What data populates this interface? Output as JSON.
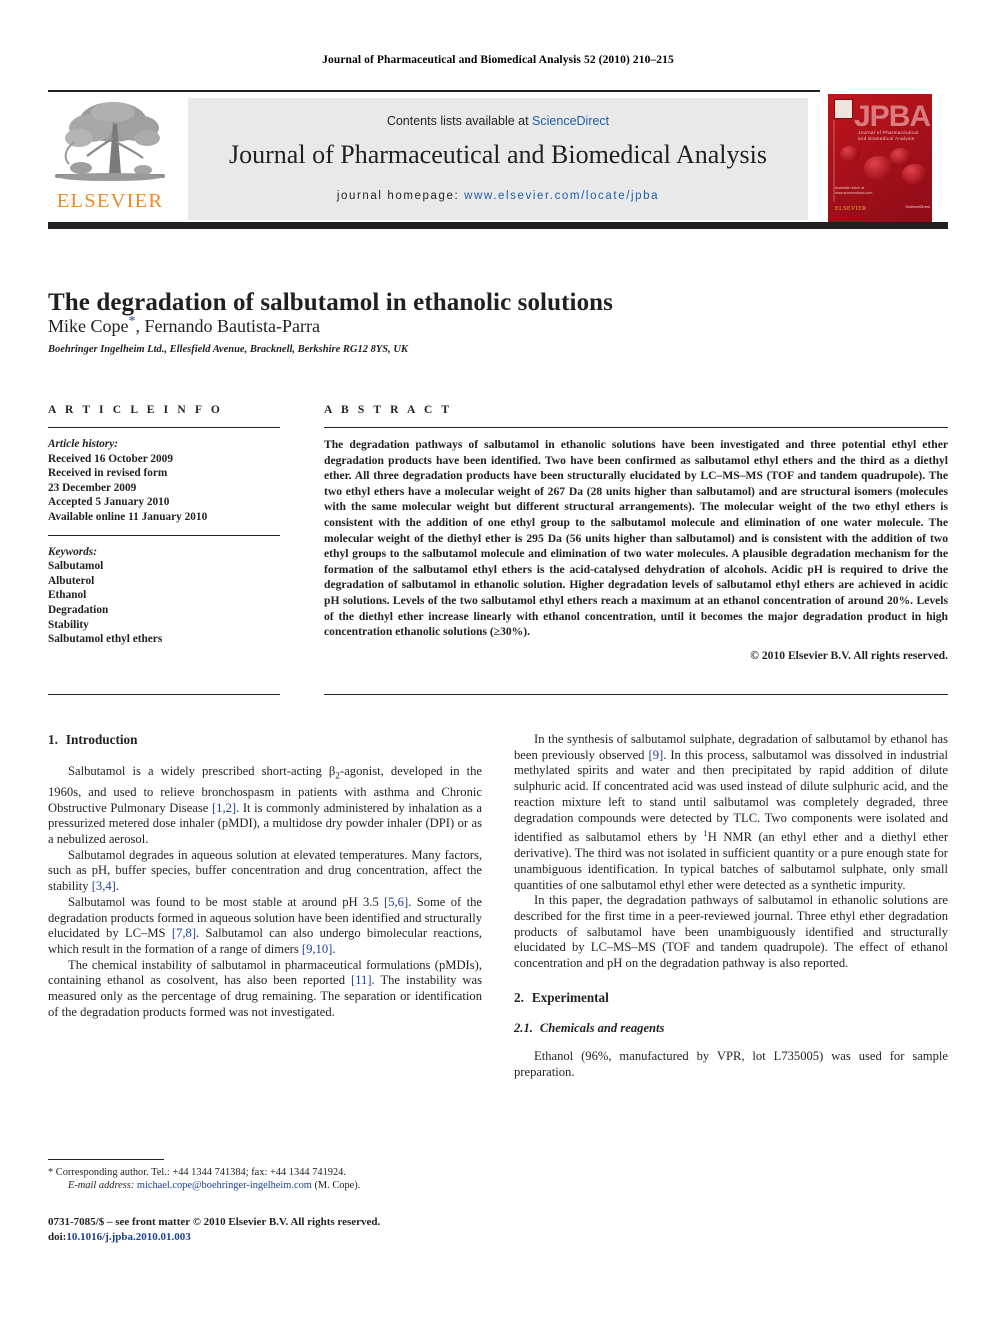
{
  "running_head": "Journal of Pharmaceutical and Biomedical Analysis 52 (2010) 210–215",
  "masthead": {
    "contents_prefix": "Contents lists available at ",
    "sciencedirect": "ScienceDirect",
    "journal_name": "Journal of Pharmaceutical and Biomedical Analysis",
    "homepage_label": "journal homepage: ",
    "homepage_url": "www.elsevier.com/locate/jpba",
    "publisher_logo_text": "ELSEVIER",
    "publisher_logo_color": "#f0892a",
    "link_color": "#1c5fa8",
    "band_color": "#e9e9ea",
    "cover": {
      "acronym": "JPBA",
      "subtitle": "Journal of Pharmaceutical and Biomedical Analysis",
      "footer_lines": "Available online at www.sciencedirect.com",
      "brand": "ScienceDirect",
      "elsevier": "ELSEVIER",
      "color": "#b31217"
    }
  },
  "article": {
    "title": "The degradation of salbutamol in ethanolic solutions",
    "authors": "Mike Cope",
    "corresponding_marker": "*",
    "authors_rest": ", Fernando Bautista-Parra",
    "affiliation": "Boehringer Ingelheim Ltd., Ellesfield Avenue, Bracknell, Berkshire RG12 8YS, UK"
  },
  "article_info": {
    "heading": "A R T I C L E   I N F O",
    "history_label": "Article history:",
    "history": [
      "Received 16 October 2009",
      "Received in revised form",
      "23 December 2009",
      "Accepted 5 January 2010",
      "Available online 11 January 2010"
    ],
    "keywords_label": "Keywords:",
    "keywords": [
      "Salbutamol",
      "Albuterol",
      "Ethanol",
      "Degradation",
      "Stability",
      "Salbutamol ethyl ethers"
    ]
  },
  "abstract": {
    "heading": "A B S T R A C T",
    "text": "The degradation pathways of salbutamol in ethanolic solutions have been investigated and three potential ethyl ether degradation products have been identified. Two have been confirmed as salbutamol ethyl ethers and the third as a diethyl ether. All three degradation products have been structurally elucidated by LC–MS–MS (TOF and tandem quadrupole). The two ethyl ethers have a molecular weight of 267 Da (28 units higher than salbutamol) and are structural isomers (molecules with the same molecular weight but different structural arrangements). The molecular weight of the two ethyl ethers is consistent with the addition of one ethyl group to the salbutamol molecule and elimination of one water molecule. The molecular weight of the diethyl ether is 295 Da (56 units higher than salbutamol) and is consistent with the addition of two ethyl groups to the salbutamol molecule and elimination of two water molecules. A plausible degradation mechanism for the formation of the salbutamol ethyl ethers is the acid-catalysed dehydration of alcohols. Acidic pH is required to drive the degradation of salbutamol in ethanolic solution. Higher degradation levels of salbutamol ethyl ethers are achieved in acidic pH solutions. Levels of the two salbutamol ethyl ethers reach a maximum at an ethanol concentration of around 20%. Levels of the diethyl ether increase linearly with ethanol concentration, until it becomes the major degradation product in high concentration ethanolic solutions (≥30%).",
    "copyright": "© 2010 Elsevier B.V. All rights reserved."
  },
  "body": {
    "intro_heading_num": "1.",
    "intro_heading": "Introduction",
    "intro_p1_a": "Salbutamol is a widely prescribed short-acting ",
    "intro_p1_beta": "β",
    "intro_p1_sub": "2",
    "intro_p1_b": "-agonist, developed in the 1960s, and used to relieve bronchospasm in patients with asthma and Chronic Obstructive Pulmonary Disease ",
    "intro_p1_ref": "[1,2]",
    "intro_p1_c": ". It is commonly administered by inhalation as a pressurized metered dose inhaler (pMDI), a multidose dry powder inhaler (DPI) or as a nebulized aerosol.",
    "intro_p2_a": "Salbutamol degrades in aqueous solution at elevated temperatures. Many factors, such as pH, buffer species, buffer concentration and drug concentration, affect the stability ",
    "intro_p2_ref": "[3,4]",
    "intro_p2_b": ".",
    "intro_p3_a": "Salbutamol was found to be most stable at around pH 3.5 ",
    "intro_p3_ref1": "[5,6]",
    "intro_p3_b": ". Some of the degradation products formed in aqueous solution have been identified and structurally elucidated by LC–MS ",
    "intro_p3_ref2": "[7,8]",
    "intro_p3_c": ". Salbutamol can also undergo bimolecular reactions, which result in the formation of a range of dimers ",
    "intro_p3_ref3": "[9,10]",
    "intro_p3_d": ".",
    "intro_p4_a": "The chemical instability of salbutamol in pharmaceutical formulations (pMDIs), containing ethanol as cosolvent, has also been reported ",
    "intro_p4_ref": "[11]",
    "intro_p4_b": ". The instability was measured only as the percentage of drug remaining. The separation or identification of the degradation products formed was not investigated.",
    "right_p1_a": "In the synthesis of salbutamol sulphate, degradation of salbutamol by ethanol has been previously observed ",
    "right_p1_ref": "[9]",
    "right_p1_b": ". In this process, salbutamol was dissolved in industrial methylated spirits and water and then precipitated by rapid addition of dilute sulphuric acid. If concentrated acid was used instead of dilute sulphuric acid, and the reaction mixture left to stand until salbutamol was completely degraded, three degradation compounds were detected by TLC. Two components were isolated and identified as salbutamol ethers by ",
    "right_p1_sup": "1",
    "right_p1_c": "H NMR (an ethyl ether and a diethyl ether derivative). The third was not isolated in sufficient quantity or a pure enough state for unambiguous identification. In typical batches of salbutamol sulphate, only small quantities of one salbutamol ethyl ether were detected as a synthetic impurity.",
    "right_p2": "In this paper, the degradation pathways of salbutamol in ethanolic solutions are described for the first time in a peer-reviewed journal. Three ethyl ether degradation products of salbutamol have been unambiguously identified and structurally elucidated by LC–MS–MS (TOF and tandem quadrupole). The effect of ethanol concentration and pH on the degradation pathway is also reported.",
    "exp_heading_num": "2.",
    "exp_heading": "Experimental",
    "exp_sub_num": "2.1.",
    "exp_sub_heading": "Chemicals and reagents",
    "exp_p1": "Ethanol (96%, manufactured by VPR, lot L735005) was used for sample preparation."
  },
  "footer": {
    "corresponding_marker": "*",
    "corresponding": " Corresponding author. Tel.: +44 1344 741384; fax: +44 1344 741924.",
    "email_label": "E-mail address:",
    "email": "michael.cope@boehringer-ingelheim.com",
    "email_suffix": " (M. Cope).",
    "issn_line": "0731-7085/$ – see front matter © 2010 Elsevier B.V. All rights reserved.",
    "doi_label": "doi:",
    "doi": "10.1016/j.jpba.2010.01.003"
  }
}
